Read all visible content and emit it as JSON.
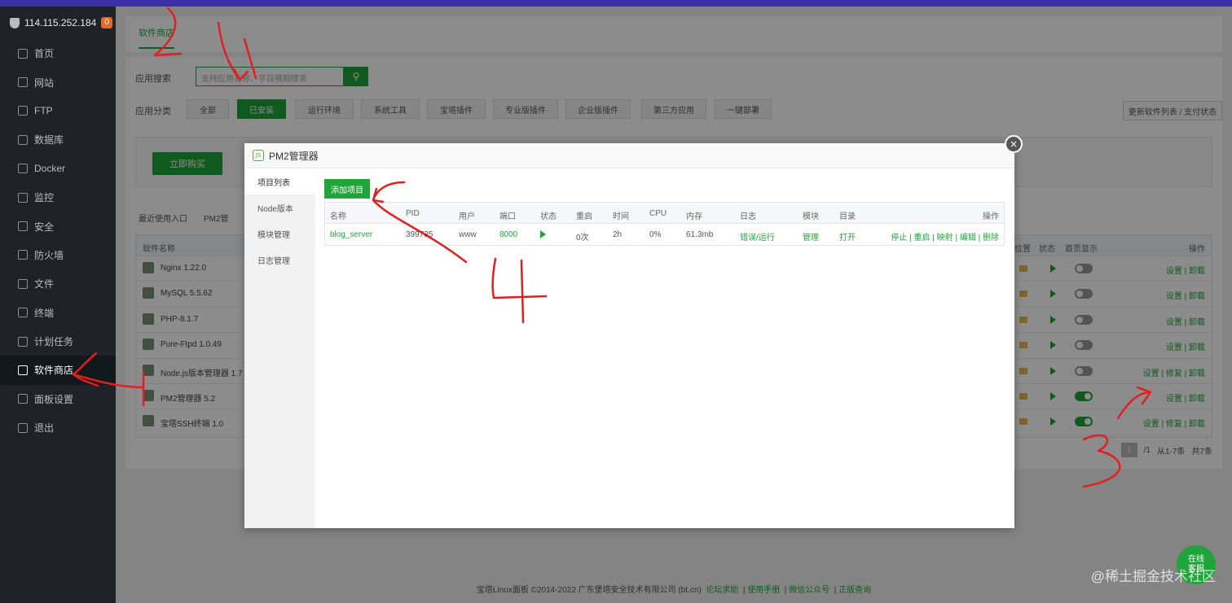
{
  "sidebar": {
    "host": "114.115.252.184",
    "host_count": "0",
    "items": [
      {
        "label": "首页",
        "name": "home"
      },
      {
        "label": "网站",
        "name": "website"
      },
      {
        "label": "FTP",
        "name": "ftp"
      },
      {
        "label": "数据库",
        "name": "database"
      },
      {
        "label": "Docker",
        "name": "docker"
      },
      {
        "label": "监控",
        "name": "monitor"
      },
      {
        "label": "安全",
        "name": "security"
      },
      {
        "label": "防火墙",
        "name": "firewall"
      },
      {
        "label": "文件",
        "name": "files"
      },
      {
        "label": "终端",
        "name": "terminal"
      },
      {
        "label": "计划任务",
        "name": "cron"
      },
      {
        "label": "软件商店",
        "name": "app-store"
      },
      {
        "label": "面板设置",
        "name": "panel-settings"
      },
      {
        "label": "退出",
        "name": "logout"
      }
    ]
  },
  "main": {
    "tab": "软件商店",
    "search_label": "应用搜索",
    "search_placeholder": "支持应用名称、字段模糊搜索",
    "category_label": "应用分类",
    "categories": [
      "全部",
      "已安装",
      "运行环境",
      "系统工具",
      "宝塔插件",
      "专业版插件",
      "企业版插件",
      "第三方应用",
      "一键部署"
    ],
    "refresh_label": "更新软件列表 / 支付状态",
    "buy_label": "立即购买",
    "recent_label": "最近使用入口",
    "recent_item": "PM2管",
    "table_head": {
      "name": "软件名称",
      "location": "位置",
      "status": "状态",
      "home_show": "首页显示",
      "ops": "操作"
    },
    "rows": [
      {
        "name": "Nginx 1.22.0",
        "ops": "设置 | 卸载",
        "toggle": false
      },
      {
        "name": "MySQL 5.5.62",
        "ops": "设置 | 卸载",
        "toggle": false
      },
      {
        "name": "PHP-8.1.7",
        "ops": "设置 | 卸载",
        "toggle": false
      },
      {
        "name": "Pure-Ftpd 1.0.49",
        "ops": "设置 | 卸载",
        "toggle": false
      },
      {
        "name": "Node.js版本管理器 1.7",
        "ops": "设置 | 修复 | 卸载",
        "toggle": false
      },
      {
        "name": "PM2管理器 5.2",
        "ops": "设置 | 卸载",
        "toggle": true
      },
      {
        "name": "宝塔SSH终端 1.0",
        "ops": "设置 | 修复 | 卸载",
        "toggle": true
      }
    ],
    "pager": {
      "current": "1",
      "total_pages": "/1",
      "range": "从1-7条",
      "total": "共7条"
    },
    "footer": {
      "copyright": "宝塔Linux面板 ©2014-2022 广东堡塔安全技术有限公司 (bt.cn)",
      "links": [
        "论坛求助",
        "使用手册",
        "微信公众号",
        "正版查询"
      ]
    }
  },
  "modal": {
    "title": "PM2管理器",
    "close": "×",
    "side_items": [
      "项目列表",
      "Node版本",
      "模块管理",
      "日志管理"
    ],
    "add_button": "添加项目",
    "columns": [
      "名称",
      "PID",
      "用户",
      "端口",
      "状态",
      "重启",
      "时间",
      "CPU",
      "内存",
      "日志",
      "模块",
      "目录",
      "操作"
    ],
    "row": {
      "name": "blog_server",
      "pid": "399735",
      "user": "www",
      "port": "8000",
      "restart": "0次",
      "time": "2h",
      "cpu": "0%",
      "memory": "61.3mb",
      "log": "错误/运行",
      "module": "管理",
      "dir": "打开",
      "ops": "停止 | 重启 | 映射 | 编辑 | 删除"
    }
  },
  "online_support": [
    "在线",
    "客服"
  ],
  "watermark": "@稀土掘金技术社区",
  "annotations": [
    "1",
    "2",
    "3",
    "4"
  ],
  "colors": {
    "accent": "#20a53a",
    "sidebar": "#1f2327",
    "annotation": "#e02020"
  }
}
